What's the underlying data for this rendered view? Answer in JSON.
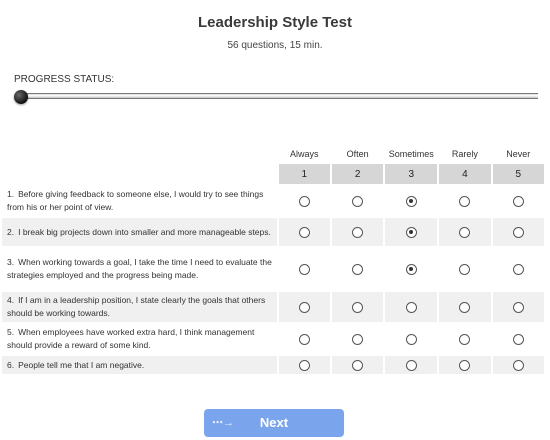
{
  "header": {
    "title": "Leadership Style Test",
    "subtitle": "56 questions, 15 min."
  },
  "progress": {
    "label": "PROGRESS STATUS:",
    "value": 0
  },
  "scale": [
    {
      "label": "Always",
      "number": "1"
    },
    {
      "label": "Often",
      "number": "2"
    },
    {
      "label": "Sometimes",
      "number": "3"
    },
    {
      "label": "Rarely",
      "number": "4"
    },
    {
      "label": "Never",
      "number": "5"
    }
  ],
  "questions": [
    {
      "index": "1.",
      "text": "Before giving feedback to someone else, I would try to see things from his or her point of view.",
      "selected": 3
    },
    {
      "index": "2.",
      "text": "I break big projects down into smaller and more manageable steps.",
      "selected": 3
    },
    {
      "index": "3.",
      "text": "When working towards a goal, I take the time I need to evaluate the strategies employed and the progress being made.",
      "selected": 3
    },
    {
      "index": "4.",
      "text": "If I am in a leadership position, I state clearly the goals that others should be working towards.",
      "selected": null
    },
    {
      "index": "5.",
      "text": "When employees have worked extra hard, I think management should provide a reward of some kind.",
      "selected": null
    },
    {
      "index": "6.",
      "text": "People tell me that I am negative.",
      "selected": null
    }
  ],
  "footer": {
    "next_label": "Next",
    "next_icon": "dotted-arrow-icon"
  }
}
